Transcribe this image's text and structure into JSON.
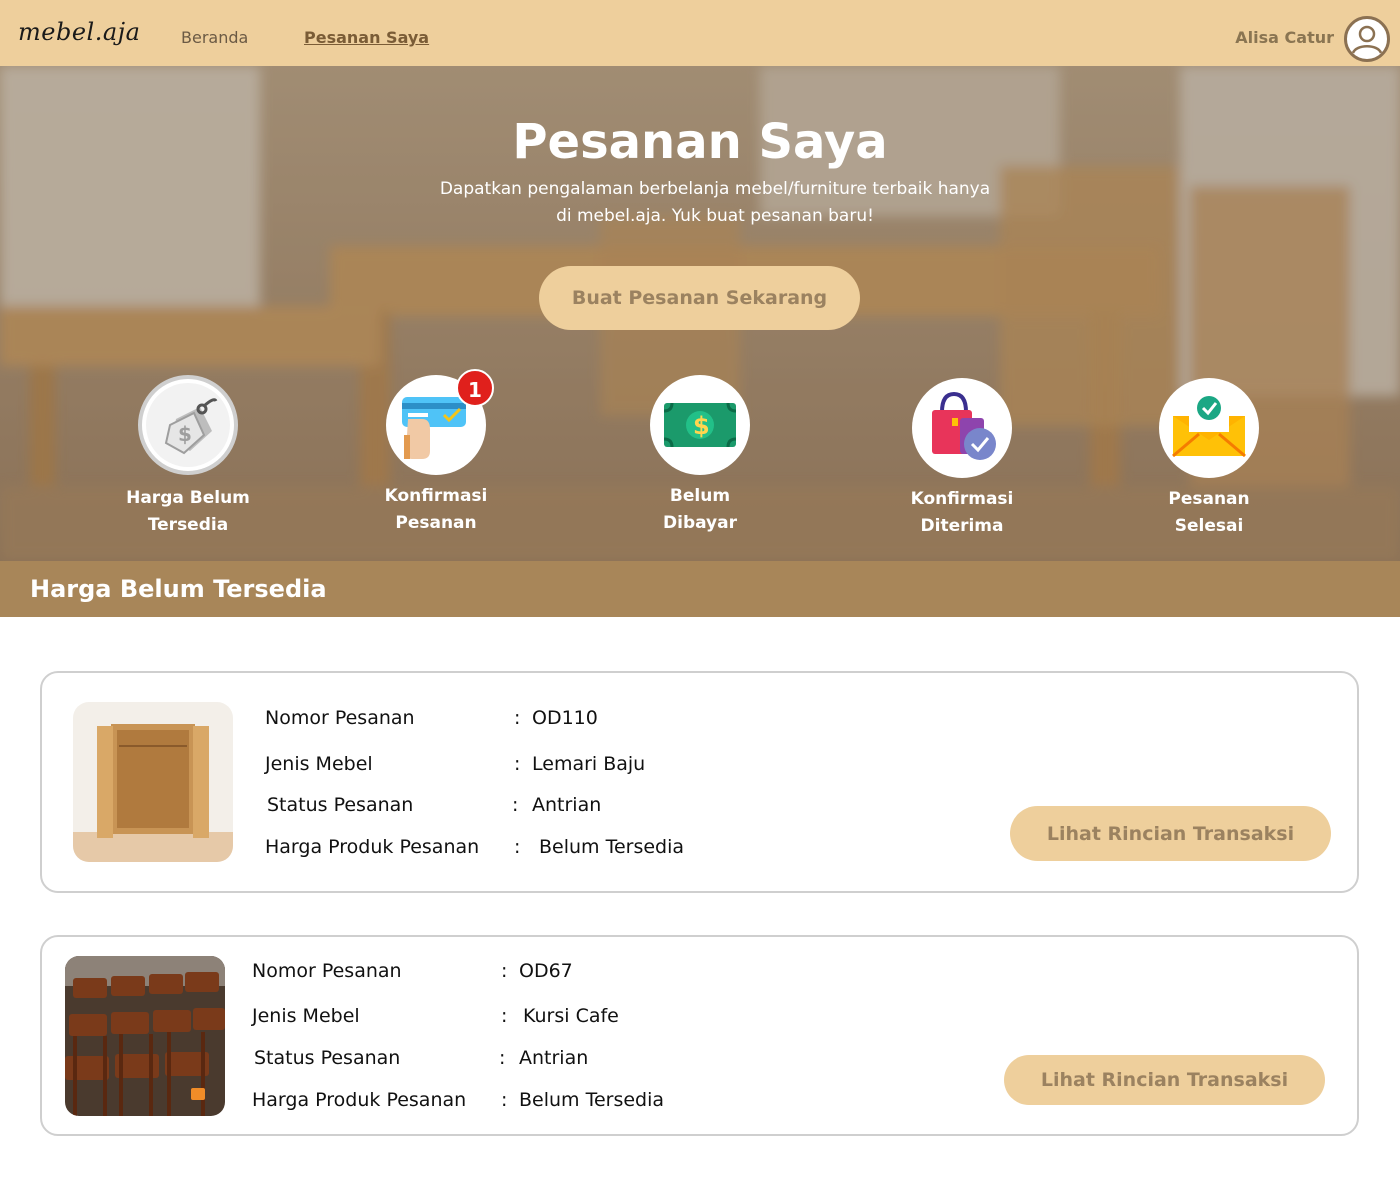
{
  "nav": {
    "logo": "mebel.aja",
    "links": [
      {
        "label": "Beranda"
      },
      {
        "label": "Pesanan Saya"
      }
    ],
    "user_name": "Alisa Catur",
    "avatar_icon": "user-avatar-icon"
  },
  "hero": {
    "title": "Pesanan Saya",
    "subtitle_line1": "Dapatkan pengalaman berbelanja mebel/furniture terbaik hanya",
    "subtitle_line2": "di mebel.aja. Yuk buat pesanan baru!",
    "cta_label": "Buat Pesanan Sekarang"
  },
  "steps": [
    {
      "label_line1": "Harga Belum",
      "label_line2": "Tersedia",
      "icon": "price-tag-icon",
      "badge": ""
    },
    {
      "label_line1": "Konfirmasi",
      "label_line2": "Pesanan",
      "icon": "card-payment-icon",
      "badge": "1"
    },
    {
      "label_line1": "Belum",
      "label_line2": "Dibayar",
      "icon": "money-bill-icon",
      "badge": ""
    },
    {
      "label_line1": "Konfirmasi",
      "label_line2": "Diterima",
      "icon": "shopping-bag-check-icon",
      "badge": ""
    },
    {
      "label_line1": "Pesanan",
      "label_line2": "Selesai",
      "icon": "envelope-check-icon",
      "badge": ""
    }
  ],
  "section": {
    "title": "Harga Belum Tersedia"
  },
  "field_labels": {
    "order_number": "Nomor Pesanan",
    "furniture_type": "Jenis Mebel",
    "status": "Status Pesanan",
    "price": "Harga Produk Pesanan",
    "separator": ":"
  },
  "orders": [
    {
      "order_number": "OD110",
      "furniture_type": "Lemari Baju",
      "status": "Antrian",
      "price": "Belum Tersedia",
      "button_label": "Lihat Rincian Transaksi",
      "image": "wardrobe-photo"
    },
    {
      "order_number": "OD67",
      "furniture_type": "Kursi Cafe",
      "status": "Antrian",
      "price": "Belum Tersedia",
      "button_label": "Lihat Rincian Transaksi",
      "image": "cafe-chairs-photo"
    }
  ],
  "colors": {
    "navbar": "#eecf9c",
    "accent_brown": "#a88659",
    "button_text": "#9b8260",
    "badge_red": "#e0201c"
  }
}
